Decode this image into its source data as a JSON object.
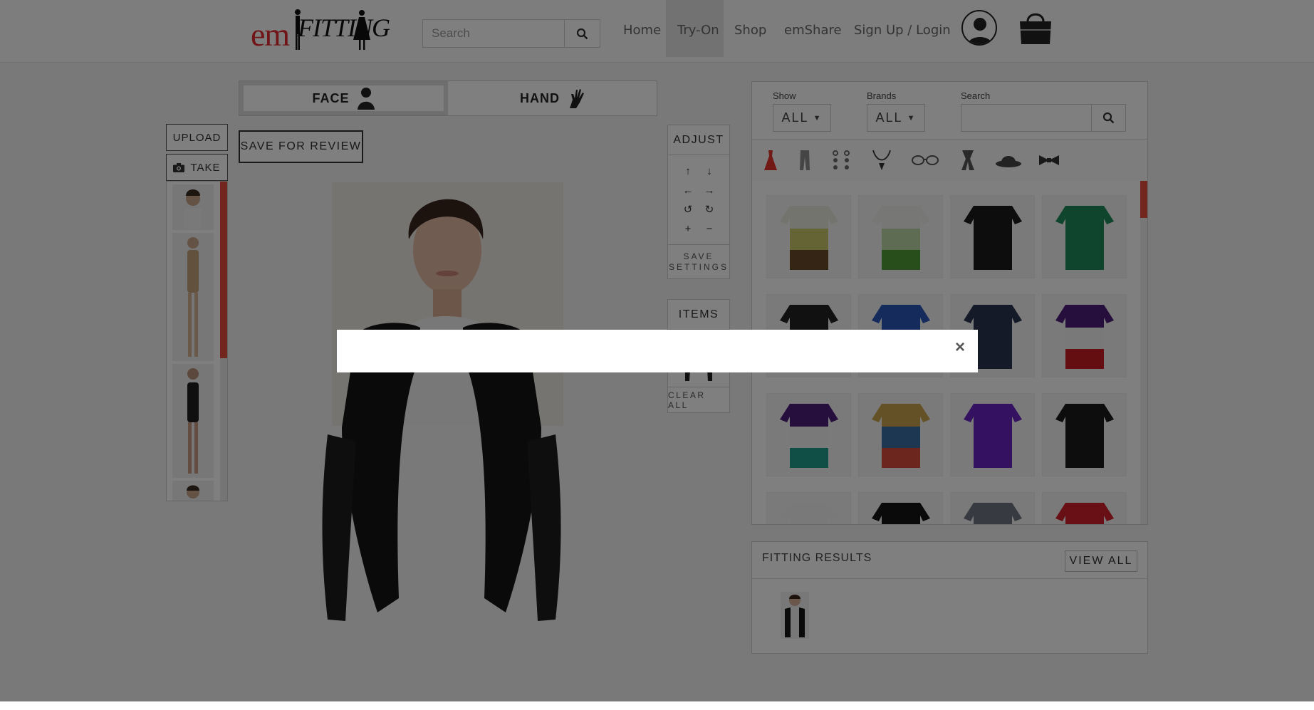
{
  "header": {
    "logo": {
      "em": "em",
      "fitting": "FITTING"
    },
    "search": {
      "placeholder": "Search",
      "value": ""
    },
    "nav": [
      {
        "label": "Home",
        "active": false
      },
      {
        "label": "Try-On",
        "active": true
      },
      {
        "label": "Shop",
        "active": false
      },
      {
        "label": "emShare",
        "active": false
      },
      {
        "label": "Sign Up / Login",
        "active": false
      }
    ],
    "icons": {
      "search": "search-icon",
      "avatar": "user-avatar-icon",
      "cart": "shopping-bag-icon"
    }
  },
  "left_panel": {
    "upload_label": "UPLOAD",
    "take_label": "TAKE",
    "take_icon": "camera-icon",
    "models_count_visible": 4
  },
  "mode_tabs": {
    "face": {
      "label": "FACE",
      "icon": "person-silhouette-icon",
      "selected": true
    },
    "hand": {
      "label": "HAND",
      "icon": "hand-icon",
      "selected": false
    }
  },
  "save_for_review_label": "SAVE FOR REVIEW",
  "adjust_panel": {
    "title": "ADJUST",
    "controls": [
      {
        "name": "move-up",
        "icon": "arrow-up-icon",
        "glyph": "↑"
      },
      {
        "name": "move-down",
        "icon": "arrow-down-icon",
        "glyph": "↓"
      },
      {
        "name": "move-left",
        "icon": "arrow-left-icon",
        "glyph": "←"
      },
      {
        "name": "move-right",
        "icon": "arrow-right-icon",
        "glyph": "→"
      },
      {
        "name": "rotate-left",
        "icon": "rotate-ccw-icon",
        "glyph": "↺"
      },
      {
        "name": "rotate-right",
        "icon": "rotate-cw-icon",
        "glyph": "↻"
      },
      {
        "name": "zoom-in",
        "icon": "plus-icon",
        "glyph": "+"
      },
      {
        "name": "zoom-out",
        "icon": "minus-icon",
        "glyph": "−"
      }
    ],
    "save_settings_line1": "SAVE",
    "save_settings_line2": "SETTINGS"
  },
  "items_panel": {
    "title": "ITEMS",
    "clear_all_label": "CLEAR ALL"
  },
  "catalog": {
    "show_label": "Show",
    "show_value": "ALL",
    "brands_label": "Brands",
    "brands_value": "ALL",
    "search_label": "Search",
    "search_value": "",
    "categories": [
      {
        "name": "dress-category-icon",
        "color": "#e0332b"
      },
      {
        "name": "pants-category-icon",
        "color": "#8a8a8a"
      },
      {
        "name": "earrings-category-icon",
        "color": "#6b6b6b"
      },
      {
        "name": "necklace-category-icon",
        "color": "#333333"
      },
      {
        "name": "glasses-category-icon",
        "color": "#555555"
      },
      {
        "name": "scarf-category-icon",
        "color": "#555555"
      },
      {
        "name": "hat-category-icon",
        "color": "#444444"
      },
      {
        "name": "bowtie-category-icon",
        "color": "#333333"
      }
    ],
    "products": [
      {
        "name": "layered-top-yellow-brown",
        "colors": [
          "#e9e9dd",
          "#c9c86a",
          "#6b4a2a"
        ]
      },
      {
        "name": "layered-top-green",
        "colors": [
          "#eef0ea",
          "#bcd9a8",
          "#4f9d36"
        ]
      },
      {
        "name": "cardigan-black",
        "colors": [
          "#1b1b1b",
          "#1b1b1b",
          "#1b1b1b"
        ]
      },
      {
        "name": "cardigan-green",
        "colors": [
          "#1f8a5b",
          "#1f8a5b",
          "#1f8a5b"
        ]
      },
      {
        "name": "blazer-black",
        "colors": [
          "#222222",
          "#222222",
          "#222222"
        ]
      },
      {
        "name": "top-blue",
        "colors": [
          "#2a56b8",
          "#2a56b8",
          "#2a56b8"
        ]
      },
      {
        "name": "dress-navy-print",
        "colors": [
          "#2b3550",
          "#2b3550",
          "#2b3550"
        ]
      },
      {
        "name": "top-purple-white-red",
        "colors": [
          "#4c1d7a",
          "#f3f3f3",
          "#c81d25"
        ]
      },
      {
        "name": "top-purple-white-teal",
        "colors": [
          "#4c1d7a",
          "#f3f3f3",
          "#1f9e8a"
        ]
      },
      {
        "name": "dress-floral",
        "colors": [
          "#c9a34a",
          "#3b6fa6",
          "#d84c3a"
        ]
      },
      {
        "name": "top-purple",
        "colors": [
          "#6b22c2",
          "#6b22c2",
          "#6b22c2"
        ]
      },
      {
        "name": "top-black-sheer",
        "colors": [
          "#1a1a1a",
          "#1a1a1a",
          "#1a1a1a"
        ]
      },
      {
        "name": "top-white",
        "colors": [
          "#f3f3f3",
          "#e6e6e6",
          "#e6e6e6"
        ]
      },
      {
        "name": "dress-black",
        "colors": [
          "#151515",
          "#151515",
          "#151515"
        ]
      },
      {
        "name": "dress-grey",
        "colors": [
          "#6f7580",
          "#6f7580",
          "#6f7580"
        ]
      },
      {
        "name": "dress-red",
        "colors": [
          "#d1212a",
          "#d1212a",
          "#d1212a"
        ]
      }
    ]
  },
  "results": {
    "title": "FITTING RESULTS",
    "view_all_label": "VIEW ALL"
  },
  "modal": {
    "close_glyph": "×"
  },
  "colors": {
    "accent": "#e74c3c",
    "brand_red": "#e3282e",
    "overlay": "rgba(0,0,0,0.5)"
  }
}
